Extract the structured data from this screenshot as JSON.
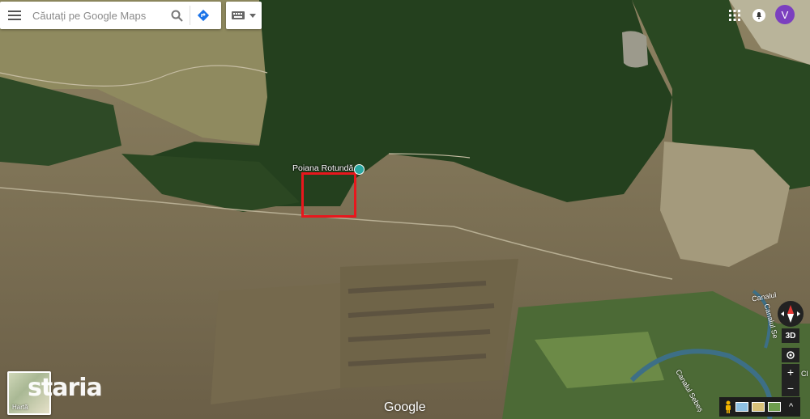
{
  "search": {
    "placeholder": "Căutați pe Google Maps"
  },
  "map": {
    "place_name": "Poiana Rotundă",
    "canal_label_1": "Canalul",
    "canal_label_2": "Canalul Se",
    "canal_label_3": "Canalul Sebeș",
    "edge_label": "Cl",
    "watermark": "staria",
    "attribution": "Google"
  },
  "layer_switcher": {
    "label": "Hartă"
  },
  "controls": {
    "tilt_label": "3D",
    "zoom_in": "+",
    "zoom_out": "−",
    "expand": "^"
  },
  "account": {
    "initial": "V",
    "color": "#7b3fbf"
  },
  "colors": {
    "highlight": "#e8171d",
    "pin": "#2aa7a0"
  }
}
